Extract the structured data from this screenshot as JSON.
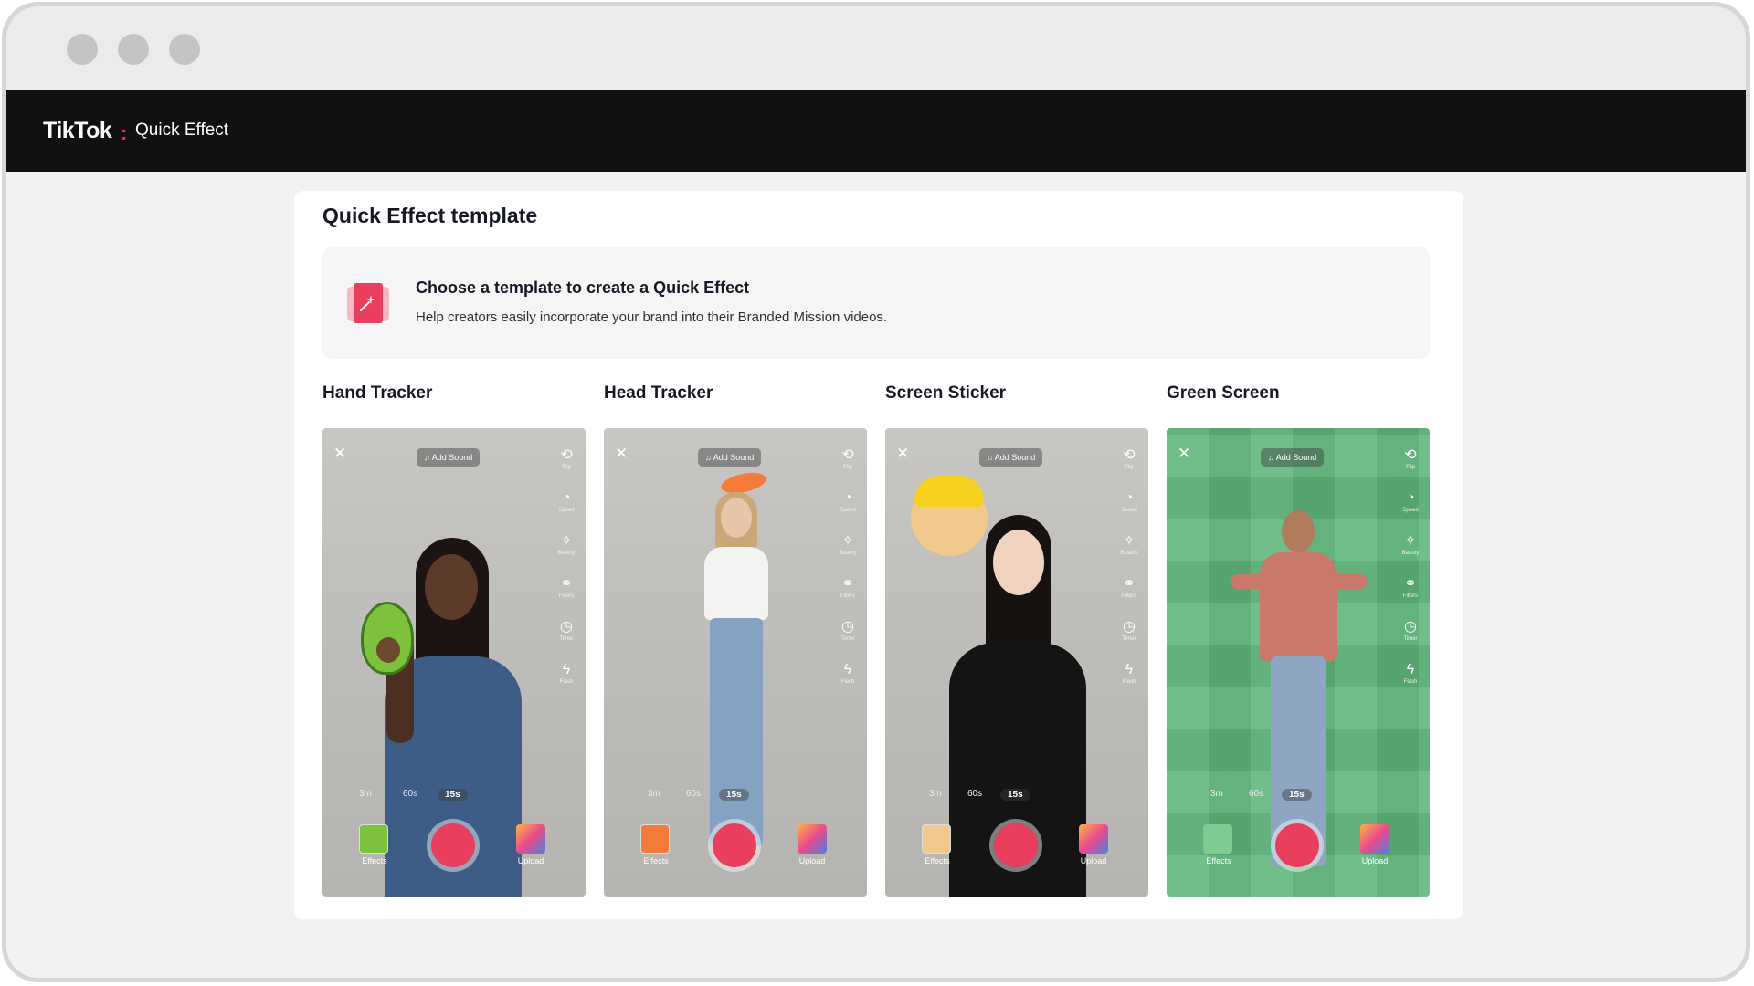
{
  "app": {
    "brand": "TikTok",
    "brand_sep": ":",
    "product": "Quick Effect"
  },
  "page": {
    "title": "Quick Effect template"
  },
  "info": {
    "title": "Choose a template to create a Quick Effect",
    "description": "Help creators easily incorporate your brand into their Branded Mission videos.",
    "icon": "sparkle-wand-icon"
  },
  "templates": [
    {
      "name": "Hand Tracker",
      "background": "grey"
    },
    {
      "name": "Head Tracker",
      "background": "grey"
    },
    {
      "name": "Screen Sticker",
      "background": "grey"
    },
    {
      "name": "Green Screen",
      "background": "green"
    }
  ],
  "camera_ui": {
    "add_sound": "♫ Add Sound",
    "side_tools": [
      "Flip",
      "Speed",
      "Beauty",
      "Filters",
      "Timer",
      "Flash"
    ],
    "durations": [
      "3m",
      "60s",
      "15s"
    ],
    "selected_duration": "15s",
    "effects_label": "Effects",
    "upload_label": "Upload"
  },
  "colors": {
    "accent": "#ea3e5e",
    "header_bg": "#111111",
    "green_screen": "#5fb67c"
  }
}
